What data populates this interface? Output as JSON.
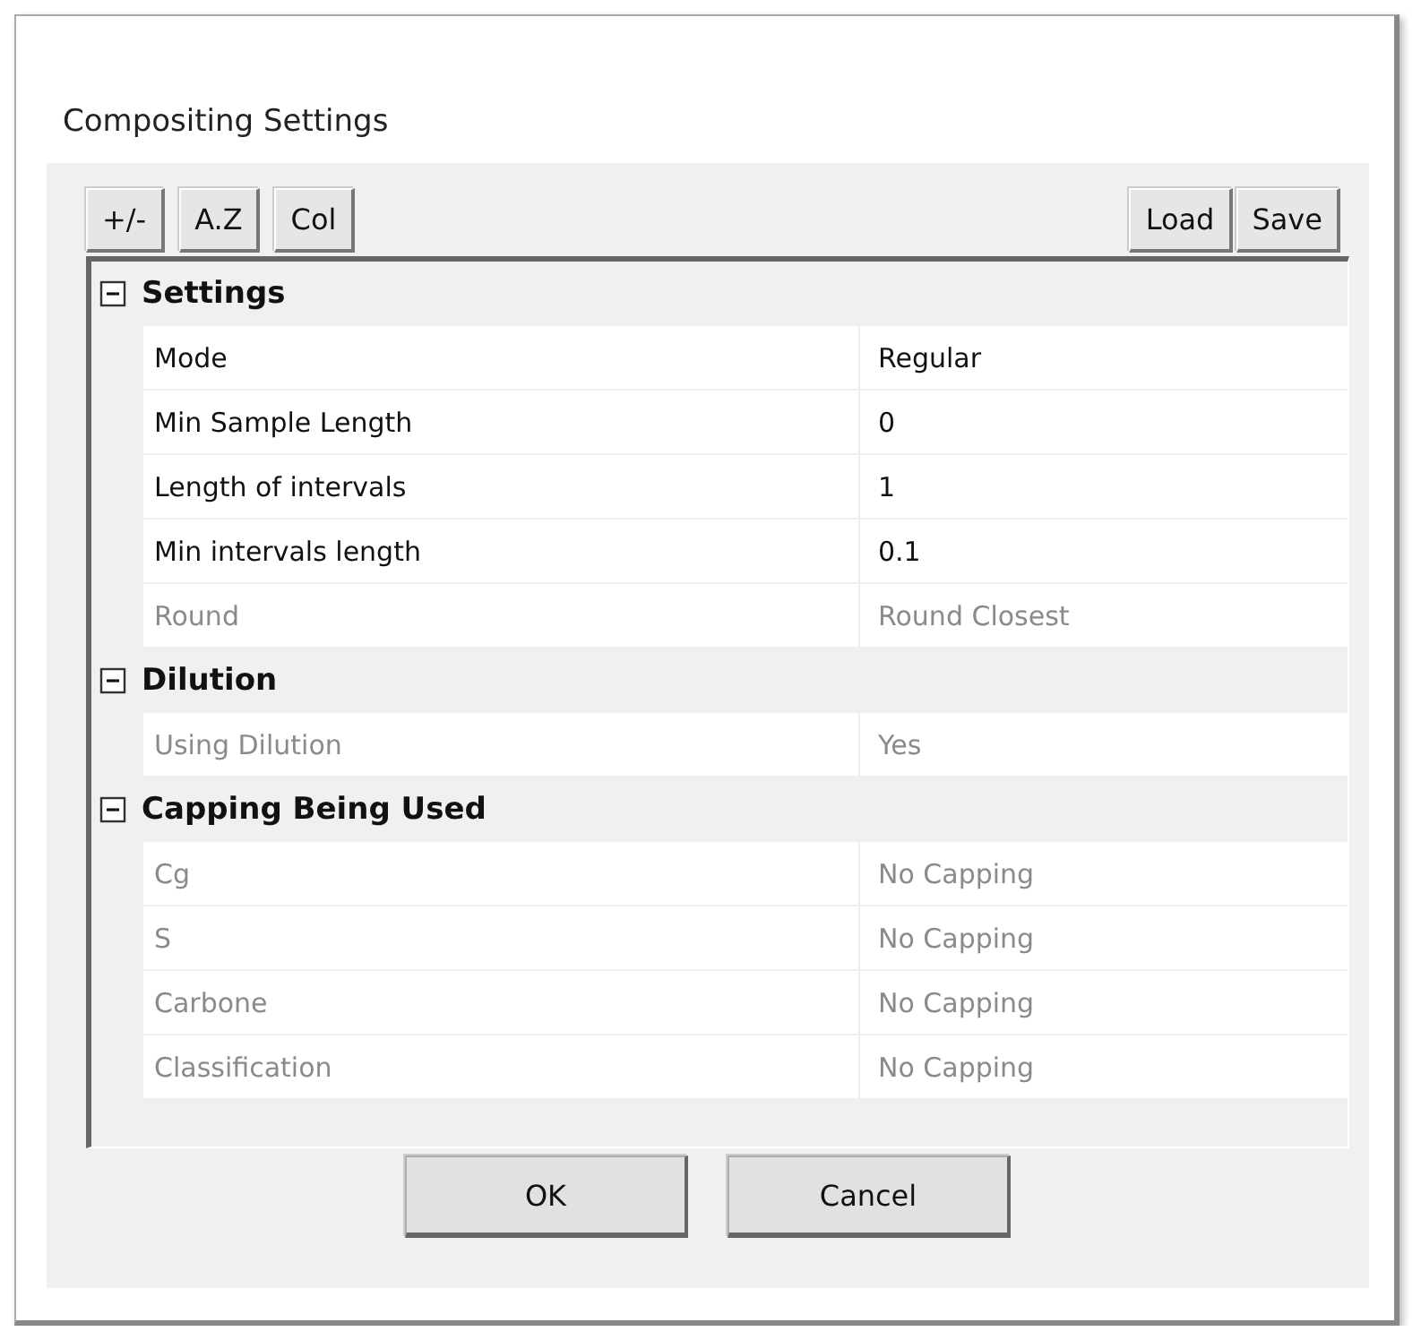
{
  "window": {
    "title": "Compositing Settings"
  },
  "toolbar": {
    "left_buttons": [
      "+/-",
      "A.Z",
      "Col"
    ],
    "right_buttons": [
      "Load",
      "Save"
    ]
  },
  "groups": [
    {
      "name": "Settings",
      "expanded": true,
      "properties": [
        {
          "label": "Mode",
          "value": "Regular",
          "disabled": false
        },
        {
          "label": "Min Sample Length",
          "value": "0",
          "disabled": false
        },
        {
          "label": "Length of intervals",
          "value": "1",
          "disabled": false
        },
        {
          "label": "Min intervals length",
          "value": "0.1",
          "disabled": false
        },
        {
          "label": "Round",
          "value": "Round Closest",
          "disabled": true
        }
      ]
    },
    {
      "name": "Dilution",
      "expanded": true,
      "properties": [
        {
          "label": "Using Dilution",
          "value": "Yes",
          "disabled": true
        }
      ]
    },
    {
      "name": "Capping Being Used",
      "expanded": true,
      "properties": [
        {
          "label": "Cg",
          "value": "No Capping",
          "disabled": true
        },
        {
          "label": "S",
          "value": "No Capping",
          "disabled": true
        },
        {
          "label": "Carbone",
          "value": "No Capping",
          "disabled": true
        },
        {
          "label": "Classification",
          "value": "No Capping",
          "disabled": true
        }
      ]
    }
  ],
  "buttons": [
    "OK",
    "Cancel"
  ]
}
